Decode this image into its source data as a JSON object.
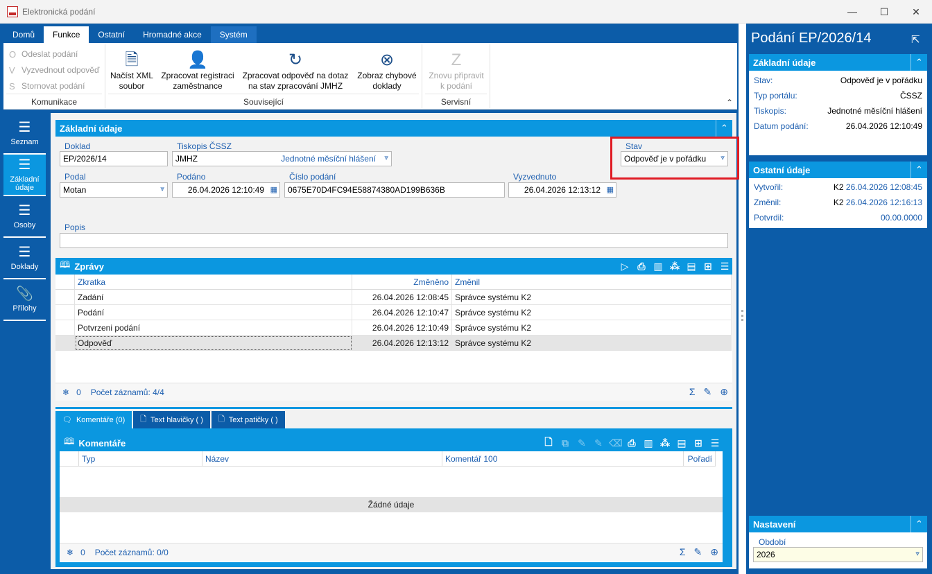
{
  "window": {
    "title": "Elektronická podání",
    "minimize": "—",
    "maximize": "☐",
    "close": "✕"
  },
  "ribbon": {
    "tabs": [
      "Domů",
      "Funkce",
      "Ostatní",
      "Hromadné akce",
      "Systém"
    ],
    "groups": {
      "komunikace": {
        "label": "Komunikace",
        "items": [
          "Odeslat podání",
          "Vyzvednout odpověď",
          "Stornovat podání"
        ]
      },
      "souvisejici": {
        "label": "Související",
        "items": [
          {
            "l1": "Načíst XML",
            "l2": "soubor"
          },
          {
            "l1": "Zpracovat registraci",
            "l2": "zaměstnance"
          },
          {
            "l1": "Zpracovat odpověď na dotaz",
            "l2": "na stav zpracování JMHZ"
          },
          {
            "l1": "Zobraz chybové",
            "l2": "doklady"
          }
        ]
      },
      "servisni": {
        "label": "Servisní",
        "items": [
          {
            "l1": "Znovu připravit",
            "l2": "k podání"
          }
        ]
      }
    }
  },
  "nav": {
    "items": [
      {
        "label": "Seznam"
      },
      {
        "label1": "Základní",
        "label2": "údaje"
      },
      {
        "label": "Osoby"
      },
      {
        "label": "Doklady"
      },
      {
        "label": "Přílohy"
      }
    ]
  },
  "basic": {
    "title": "Základní údaje",
    "doklad_label": "Doklad",
    "doklad": "EP/2026/14",
    "tiskopis_label": "Tiskopis ČSSZ",
    "tiskopis": "JMHZ",
    "tiskopis_name": "Jednotné měsíční hlášení",
    "stav_label": "Stav",
    "stav": "Odpověď je v pořádku",
    "podal_label": "Podal",
    "podal": "Motan",
    "podano_label": "Podáno",
    "podano": "26.04.2026 12:10:49",
    "cislo_label": "Číslo podání",
    "cislo": "0675E70D4FC94E58874380AD199B636B",
    "vyzvednuto_label": "Vyzvednuto",
    "vyzvednuto": "26.04.2026 12:13:12",
    "popis_label": "Popis",
    "popis": ""
  },
  "zpravy": {
    "title": "Zprávy",
    "columns": [
      "Zkratka",
      "Změněno",
      "Změnil"
    ],
    "rows": [
      [
        "Zadání",
        "26.04.2026 12:08:45",
        "Správce systému K2"
      ],
      [
        "Podání",
        "26.04.2026 12:10:47",
        "Správce systému K2"
      ],
      [
        "Potvrzeni podání",
        "26.04.2026 12:10:49",
        "Správce systému K2"
      ],
      [
        "Odpověď",
        "26.04.2026 12:13:12",
        "Správce systému K2"
      ]
    ],
    "footer_count": "0",
    "footer_records": "Počet záznamů: 4/4"
  },
  "subtabs": [
    "Komentáře (0)",
    "Text hlavičky ( )",
    "Text patičky ( )"
  ],
  "komentare": {
    "title": "Komentáře",
    "columns": [
      "Typ",
      "Název",
      "Komentář 100",
      "Pořadí"
    ],
    "empty": "Žádné údaje",
    "footer_count": "0",
    "footer_records": "Počet záznamů: 0/0"
  },
  "right": {
    "title": "Podání EP/2026/14",
    "basic_title": "Základní údaje",
    "basic": [
      {
        "k": "Stav:",
        "v": "Odpověď je v pořádku"
      },
      {
        "k": "Typ portálu:",
        "v": "ČSSZ"
      },
      {
        "k": "Tiskopis:",
        "v": "Jednotné měsíční hlášení"
      },
      {
        "k": "Datum podání:",
        "v": "26.04.2026 12:10:49"
      }
    ],
    "other_title": "Ostatní údaje",
    "other": [
      {
        "k": "Vytvořil:",
        "who": "K2",
        "v": "26.04.2026 12:08:45"
      },
      {
        "k": "Změnil:",
        "who": "K2",
        "v": "26.04.2026 12:16:13"
      },
      {
        "k": "Potvrdil:",
        "who": "",
        "v": "00.00.0000"
      }
    ],
    "settings_title": "Nastavení",
    "obdobi_label": "Období",
    "obdobi": "2026"
  },
  "colors": {
    "brand": "#0c5ca8",
    "accent": "#0b97e0",
    "highlight": "#e01b24"
  }
}
